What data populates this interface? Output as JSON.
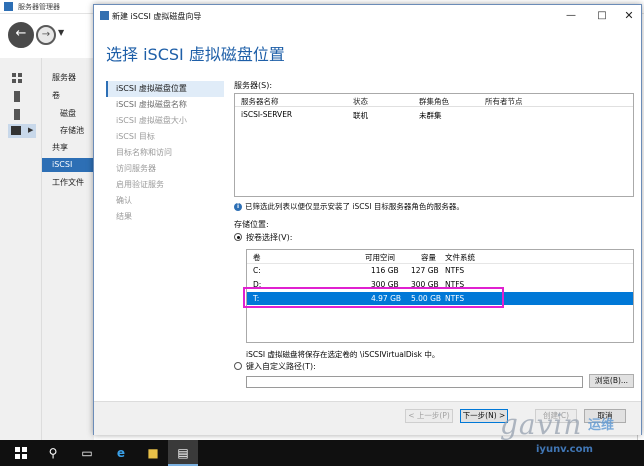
{
  "server_manager": {
    "title": "服务器管理器",
    "sidebar": [
      "服务器",
      "卷",
      "磁盘",
      "存储池",
      "共享",
      "iSCSI",
      "工作文件"
    ],
    "sidebar_selected": "iSCSI"
  },
  "wizard": {
    "title": "新建 iSCSI 虚拟磁盘向导",
    "heading": "选择 iSCSI 虚拟磁盘位置",
    "steps": [
      {
        "label": "iSCSI 虚拟磁盘位置",
        "state": "active"
      },
      {
        "label": "iSCSI 虚拟磁盘名称",
        "state": "done"
      },
      {
        "label": "iSCSI 虚拟磁盘大小",
        "state": "pending"
      },
      {
        "label": "iSCSI 目标",
        "state": "pending"
      },
      {
        "label": "目标名称和访问",
        "state": "pending"
      },
      {
        "label": "访问服务器",
        "state": "pending"
      },
      {
        "label": "启用验证服务",
        "state": "pending"
      },
      {
        "label": "确认",
        "state": "pending"
      },
      {
        "label": "结果",
        "state": "pending"
      }
    ],
    "server_label": "服务器(S):",
    "server_columns": [
      "服务器名称",
      "状态",
      "群集角色",
      "所有者节点"
    ],
    "server_rows": [
      [
        "iSCSI-SERVER",
        "联机",
        "未群集",
        ""
      ]
    ],
    "info_text": "已筛选此列表以便仅显示安装了 iSCSI 目标服务器角色的服务器。",
    "storage_label": "存储位置:",
    "by_volume_label": "按卷选择(V):",
    "volume_columns": [
      "卷",
      "可用空间",
      "容量",
      "文件系统"
    ],
    "volume_rows": [
      [
        "C:",
        "116 GB",
        "127 GB",
        "NTFS"
      ],
      [
        "D:",
        "300 GB",
        "300 GB",
        "NTFS"
      ],
      [
        "T:",
        "4.97 GB",
        "5.00 GB",
        "NTFS"
      ]
    ],
    "selected_volume_index": 2,
    "save_note": "iSCSI 虚拟磁盘将保存在选定卷的 \\iSCSIVirtualDisk 中。",
    "custom_path_label": "键入自定义路径(T):",
    "custom_path_value": "",
    "browse_button": "浏览(B)...",
    "prev_button": "< 上一步(P)",
    "next_button": "下一步(N) >",
    "create_button": "创建(C)",
    "cancel_button": "取消"
  },
  "watermark": {
    "brand": "gavin",
    "site": "iyunv.com",
    "cn": "运维"
  },
  "colors": {
    "accent": "#2d6fb5",
    "heading": "#1e5fa8",
    "selection": "#0078d7",
    "highlight_box": "#e020d0"
  }
}
